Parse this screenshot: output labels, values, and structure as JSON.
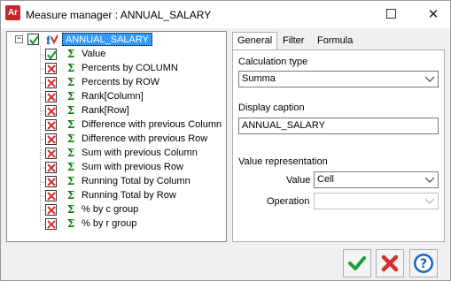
{
  "window": {
    "title": "Measure manager : ANNUAL_SALARY",
    "app_icon_text": "Ar"
  },
  "tree": {
    "root_label": "ANNUAL_SALARY",
    "items": [
      {
        "label": "Value",
        "checked": true
      },
      {
        "label": "Percents by COLUMN",
        "checked": false
      },
      {
        "label": "Percents by ROW",
        "checked": false
      },
      {
        "label": "Rank[Column]",
        "checked": false
      },
      {
        "label": "Rank[Row]",
        "checked": false
      },
      {
        "label": "Difference with previous Column",
        "checked": false
      },
      {
        "label": "Difference with previous Row",
        "checked": false
      },
      {
        "label": "Sum with previous Column",
        "checked": false
      },
      {
        "label": "Sum with previous Row",
        "checked": false
      },
      {
        "label": "Running Total by Column",
        "checked": false
      },
      {
        "label": "Running Total by Row",
        "checked": false
      },
      {
        "label": "% by c group",
        "checked": false
      },
      {
        "label": "% by r group",
        "checked": false
      }
    ]
  },
  "tabs": [
    {
      "label": "General",
      "active": true
    },
    {
      "label": "Filter",
      "active": false
    },
    {
      "label": "Formula",
      "active": false
    }
  ],
  "general": {
    "calc_type_label": "Calculation type",
    "calc_type_value": "Summa",
    "display_caption_label": "Display caption",
    "display_caption_value": "ANNUAL_SALARY",
    "value_representation_label": "Value representation",
    "value_label": "Value",
    "value_value": "Cell",
    "operation_label": "Operation",
    "operation_value": ""
  },
  "buttons": {
    "ok_icon": "checkmark-icon",
    "cancel_icon": "cross-icon",
    "help_icon": "question-icon"
  },
  "colors": {
    "selection": "#3399ff",
    "sigma": "#0a7a0a",
    "ok": "#1e9e3a",
    "cancel": "#d32f2f",
    "help": "#1565c0"
  }
}
